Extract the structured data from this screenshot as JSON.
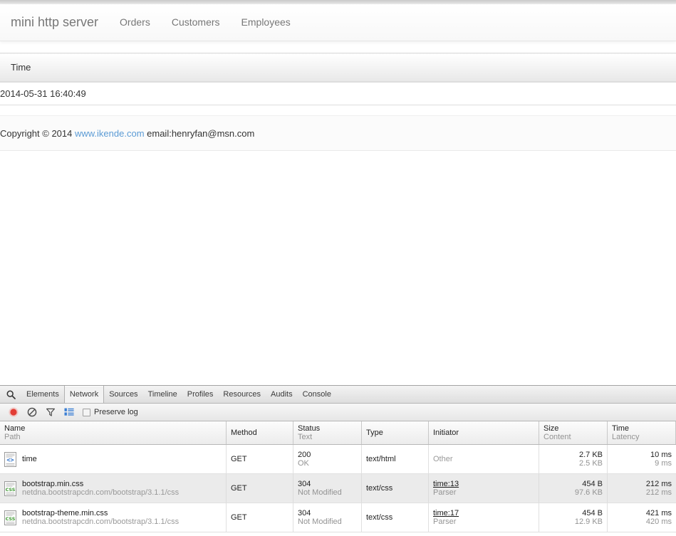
{
  "page": {
    "navbar": {
      "brand": "mini http server",
      "links": [
        {
          "label": "Orders"
        },
        {
          "label": "Customers"
        },
        {
          "label": "Employees"
        }
      ]
    },
    "table": {
      "columns": [
        "Time"
      ],
      "rows": [
        {
          "time": "2014-05-31 16:40:49"
        }
      ]
    },
    "footer": {
      "prefix": "Copyright © 2014 ",
      "link": "www.ikende.com",
      "suffix": " email:henryfan@msn.com"
    }
  },
  "devtools": {
    "search_icon": "search-icon",
    "tabs": [
      {
        "label": "Elements",
        "active": false
      },
      {
        "label": "Network",
        "active": true
      },
      {
        "label": "Sources",
        "active": false
      },
      {
        "label": "Timeline",
        "active": false
      },
      {
        "label": "Profiles",
        "active": false
      },
      {
        "label": "Resources",
        "active": false
      },
      {
        "label": "Audits",
        "active": false
      },
      {
        "label": "Console",
        "active": false
      }
    ],
    "toolbar": {
      "record_icon": "record-button-icon",
      "clear_icon": "clear-icon",
      "filter_icon": "filter-icon",
      "grouping_icon": "large-rows-icon",
      "preserve_log_label": "Preserve log",
      "preserve_log_checked": false,
      "record_color": "#e23c34"
    },
    "network": {
      "headers": [
        {
          "main": "Name",
          "sub": "Path"
        },
        {
          "main": "Method",
          "sub": ""
        },
        {
          "main": "Status",
          "sub": "Text"
        },
        {
          "main": "Type",
          "sub": ""
        },
        {
          "main": "Initiator",
          "sub": ""
        },
        {
          "main": "Size",
          "sub": "Content"
        },
        {
          "main": "Time",
          "sub": "Latency"
        }
      ],
      "rows": [
        {
          "icon": "html-file-icon",
          "name": "time",
          "path": "",
          "method": "GET",
          "status": "200",
          "status_text": "OK",
          "type": "text/html",
          "initiator": "Other",
          "initiator_sub": "",
          "initiator_is_link": false,
          "size": "2.7 KB",
          "content": "2.5 KB",
          "time": "10 ms",
          "latency": "9 ms"
        },
        {
          "icon": "css-file-icon",
          "name": "bootstrap.min.css",
          "path": "netdna.bootstrapcdn.com/bootstrap/3.1.1/css",
          "method": "GET",
          "status": "304",
          "status_text": "Not Modified",
          "type": "text/css",
          "initiator": "time:13",
          "initiator_sub": "Parser",
          "initiator_is_link": true,
          "size": "454 B",
          "content": "97.6 KB",
          "time": "212 ms",
          "latency": "212 ms"
        },
        {
          "icon": "css-file-icon",
          "name": "bootstrap-theme.min.css",
          "path": "netdna.bootstrapcdn.com/bootstrap/3.1.1/css",
          "method": "GET",
          "status": "304",
          "status_text": "Not Modified",
          "type": "text/css",
          "initiator": "time:17",
          "initiator_sub": "Parser",
          "initiator_is_link": true,
          "size": "454 B",
          "content": "12.9 KB",
          "time": "421 ms",
          "latency": "420 ms"
        }
      ]
    }
  }
}
